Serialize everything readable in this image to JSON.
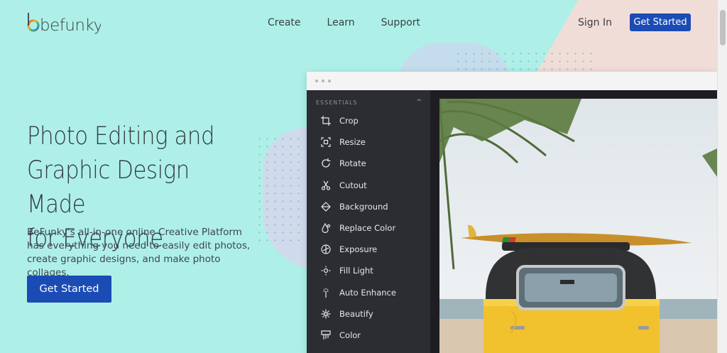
{
  "brand": {
    "name": "befunky"
  },
  "nav": {
    "items": [
      "Create",
      "Learn",
      "Support"
    ],
    "sign_in": "Sign In",
    "get_started": "Get Started"
  },
  "hero": {
    "title_lines": [
      "Photo Editing and",
      "Graphic Design Made",
      "for Everyone"
    ],
    "subtitle": "BeFunky's all-in-one online Creative Platform has everything you need to easily edit photos, create graphic designs, and make photo collages.",
    "cta": "Get Started"
  },
  "editor": {
    "section_label": "ESSENTIALS",
    "tools": [
      {
        "label": "Crop",
        "icon": "crop-icon"
      },
      {
        "label": "Resize",
        "icon": "resize-icon"
      },
      {
        "label": "Rotate",
        "icon": "rotate-icon"
      },
      {
        "label": "Cutout",
        "icon": "scissors-icon"
      },
      {
        "label": "Background",
        "icon": "background-icon"
      },
      {
        "label": "Replace Color",
        "icon": "droplet-icon"
      },
      {
        "label": "Exposure",
        "icon": "exposure-icon"
      },
      {
        "label": "Fill Light",
        "icon": "sun-icon"
      },
      {
        "label": "Auto Enhance",
        "icon": "magic-wand-icon"
      },
      {
        "label": "Beautify",
        "icon": "sparkle-icon"
      },
      {
        "label": "Color",
        "icon": "color-icon"
      }
    ]
  },
  "colors": {
    "background": "#aef0e8",
    "accent": "#1b4bb4",
    "sidebar": "#2c2d33"
  }
}
